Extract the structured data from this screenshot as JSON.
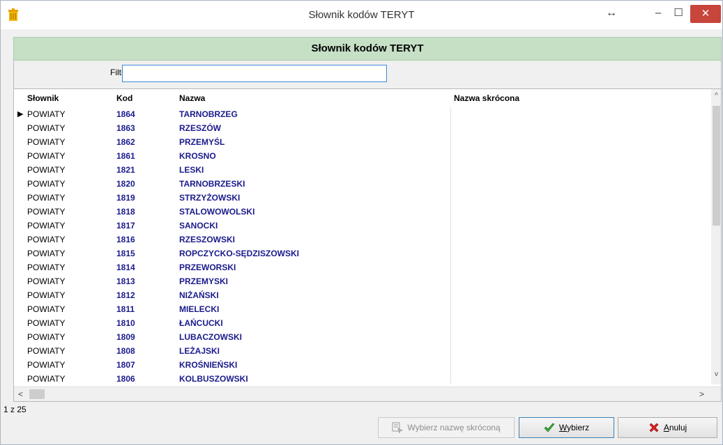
{
  "window": {
    "title": "Słownik kodów TERYT",
    "controls": {
      "resize": "↔",
      "minimize": "–",
      "maximize": "☐",
      "close": "✕"
    }
  },
  "header": {
    "title": "Słownik kodów TERYT",
    "color": "#c6e0c6"
  },
  "filter": {
    "label": "Filtr:",
    "value": "",
    "placeholder": ""
  },
  "grid": {
    "columns": [
      "Słownik",
      "Kod",
      "Nazwa",
      "Nazwa skrócona"
    ],
    "current_row_marker": "▶",
    "rows": [
      {
        "slownik": "POWIATY",
        "kod": "1864",
        "nazwa": "TARNOBRZEG",
        "skrocona": ""
      },
      {
        "slownik": "POWIATY",
        "kod": "1863",
        "nazwa": "RZESZÓW",
        "skrocona": ""
      },
      {
        "slownik": "POWIATY",
        "kod": "1862",
        "nazwa": "PRZEMYŚL",
        "skrocona": ""
      },
      {
        "slownik": "POWIATY",
        "kod": "1861",
        "nazwa": "KROSNO",
        "skrocona": ""
      },
      {
        "slownik": "POWIATY",
        "kod": "1821",
        "nazwa": "LESKI",
        "skrocona": ""
      },
      {
        "slownik": "POWIATY",
        "kod": "1820",
        "nazwa": "TARNOBRZESKI",
        "skrocona": ""
      },
      {
        "slownik": "POWIATY",
        "kod": "1819",
        "nazwa": "STRZYŻOWSKI",
        "skrocona": ""
      },
      {
        "slownik": "POWIATY",
        "kod": "1818",
        "nazwa": "STALOWOWOLSKI",
        "skrocona": ""
      },
      {
        "slownik": "POWIATY",
        "kod": "1817",
        "nazwa": "SANOCKI",
        "skrocona": ""
      },
      {
        "slownik": "POWIATY",
        "kod": "1816",
        "nazwa": "RZESZOWSKI",
        "skrocona": ""
      },
      {
        "slownik": "POWIATY",
        "kod": "1815",
        "nazwa": "ROPCZYCKO-SĘDZISZOWSKI",
        "skrocona": ""
      },
      {
        "slownik": "POWIATY",
        "kod": "1814",
        "nazwa": "PRZEWORSKI",
        "skrocona": ""
      },
      {
        "slownik": "POWIATY",
        "kod": "1813",
        "nazwa": "PRZEMYSKI",
        "skrocona": ""
      },
      {
        "slownik": "POWIATY",
        "kod": "1812",
        "nazwa": "NIŻAŃSKI",
        "skrocona": ""
      },
      {
        "slownik": "POWIATY",
        "kod": "1811",
        "nazwa": "MIELECKI",
        "skrocona": ""
      },
      {
        "slownik": "POWIATY",
        "kod": "1810",
        "nazwa": "ŁAŃCUCKI",
        "skrocona": ""
      },
      {
        "slownik": "POWIATY",
        "kod": "1809",
        "nazwa": "LUBACZOWSKI",
        "skrocona": ""
      },
      {
        "slownik": "POWIATY",
        "kod": "1808",
        "nazwa": "LEŻAJSKI",
        "skrocona": ""
      },
      {
        "slownik": "POWIATY",
        "kod": "1807",
        "nazwa": "KROŚNIEŃSKI",
        "skrocona": ""
      },
      {
        "slownik": "POWIATY",
        "kod": "1806",
        "nazwa": "KOLBUSZOWSKI",
        "skrocona": ""
      }
    ]
  },
  "scrollbars": {
    "up": "^",
    "down": "v",
    "left": "<",
    "right": ">"
  },
  "pager": {
    "text": "1 z 25"
  },
  "buttons": {
    "short_name": {
      "label": "Wybierz nazwę skróconą",
      "icon": "pick-short-icon",
      "enabled": false
    },
    "select": {
      "label_underline": "W",
      "label_rest": "ybierz",
      "icon": "checkmark-icon"
    },
    "cancel": {
      "label_underline": "A",
      "label_rest": "nuluj",
      "icon": "red-x-icon"
    }
  },
  "colors": {
    "code_text": "#1a1a8c",
    "close_button": "#c7453a",
    "header_band": "#c6e0c6"
  }
}
